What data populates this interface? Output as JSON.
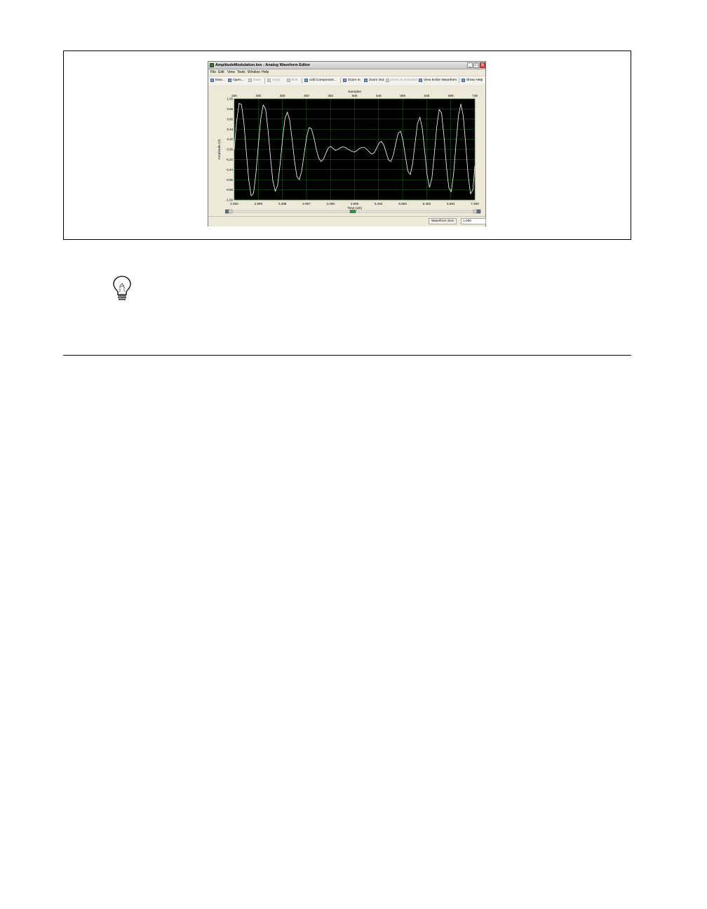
{
  "window": {
    "title": "AmplitudeModulation.lws - Analog Waveform Editor",
    "minimize_label": "_",
    "maximize_label": "□",
    "close_label": "✕"
  },
  "menu": {
    "items": [
      "File",
      "Edit",
      "View",
      "Tools",
      "Window",
      "Help"
    ]
  },
  "toolbar": {
    "new_label": "New...",
    "open_label": "Open...",
    "save_label": "Save",
    "copy_label": "Copy",
    "edit_label": "Edit",
    "add_component_label": "Add Component...",
    "zoom_in_label": "Zoom In",
    "zoom_out_label": "Zoom Out",
    "zoom_to_selection_label": "Zoom to Selection",
    "view_entire_label": "View Entire Waveform",
    "show_help_label": "Show Help"
  },
  "status": {
    "label": "Waveform Size",
    "value": "1,000"
  },
  "icons": {
    "tip": "lightbulb-icon"
  },
  "chart_data": {
    "type": "line",
    "top_axis_label": "Samples",
    "xlabel": "Time (uS)",
    "ylabel": "Amplitude (V)",
    "top_ticks": [
      "250",
      "300",
      "350",
      "400",
      "450",
      "500",
      "548",
      "599",
      "649",
      "699",
      "749"
    ],
    "bottom_ticks": [
      "2.500",
      "2.999",
      "3.498",
      "3.997",
      "4.496",
      "4.995",
      "5.494",
      "5.993",
      "6.492",
      "6.991",
      "7.490"
    ],
    "y_ticks": [
      "1.00",
      "0.88",
      "0.66",
      "0.44",
      "0.22",
      "0.00",
      "-0.22",
      "-0.44",
      "-0.66",
      "-0.88",
      "-1.00"
    ],
    "xlim": [
      2.5,
      7.49
    ],
    "ylim": [
      -1.0,
      1.0
    ],
    "grid": true,
    "background": "#000000",
    "grid_color": "#1f6b1f",
    "line_color": "#ffffff",
    "series": [
      {
        "x": [
          2.5,
          2.55,
          2.6,
          2.65,
          2.7,
          2.75,
          2.8,
          2.85,
          2.9,
          2.95,
          3.0,
          3.05,
          3.1,
          3.15,
          3.2,
          3.25,
          3.3,
          3.35,
          3.4,
          3.45,
          3.5,
          3.55,
          3.6,
          3.65,
          3.7,
          3.75,
          3.8,
          3.85,
          3.9,
          3.95,
          4.0,
          4.05,
          4.1,
          4.15,
          4.2,
          4.25,
          4.3,
          4.35,
          4.4,
          4.45,
          4.5,
          4.55,
          4.6,
          4.65,
          4.7,
          4.75,
          4.8,
          4.85,
          4.9,
          4.95,
          5.0,
          5.05,
          5.1,
          5.15,
          5.2,
          5.25,
          5.3,
          5.35,
          5.4,
          5.45,
          5.5,
          5.55,
          5.6,
          5.65,
          5.7,
          5.75,
          5.8,
          5.85,
          5.9,
          5.95,
          6.0,
          6.05,
          6.1,
          6.15,
          6.2,
          6.25,
          6.3,
          6.35,
          6.4,
          6.45,
          6.5,
          6.55,
          6.6,
          6.65,
          6.7,
          6.75,
          6.8,
          6.85,
          6.9,
          6.95,
          7.0,
          7.05,
          7.1,
          7.15,
          7.2,
          7.25,
          7.3,
          7.35,
          7.4,
          7.45,
          7.49
        ],
        "y": [
          0.0,
          0.57,
          0.91,
          0.89,
          0.52,
          -0.05,
          -0.6,
          -0.92,
          -0.87,
          -0.47,
          0.09,
          0.61,
          0.88,
          0.8,
          0.39,
          -0.15,
          -0.62,
          -0.83,
          -0.71,
          -0.3,
          0.19,
          0.6,
          0.74,
          0.58,
          0.2,
          -0.23,
          -0.54,
          -0.6,
          -0.42,
          -0.09,
          0.24,
          0.43,
          0.41,
          0.24,
          0.01,
          -0.17,
          -0.24,
          -0.19,
          -0.08,
          0.03,
          0.06,
          0.02,
          -0.02,
          0.0,
          0.03,
          0.05,
          0.04,
          0.01,
          -0.02,
          -0.04,
          -0.05,
          -0.02,
          0.02,
          0.04,
          0.04,
          0.0,
          -0.05,
          -0.09,
          -0.07,
          0.02,
          0.12,
          0.16,
          0.09,
          -0.06,
          -0.21,
          -0.24,
          -0.11,
          0.12,
          0.32,
          0.36,
          0.18,
          -0.14,
          -0.43,
          -0.5,
          -0.28,
          0.12,
          0.51,
          0.64,
          0.42,
          -0.03,
          -0.51,
          -0.75,
          -0.57,
          -0.09,
          0.45,
          0.79,
          0.72,
          0.26,
          -0.32,
          -0.76,
          -0.84,
          -0.48,
          0.12,
          0.67,
          0.9,
          0.66,
          0.1,
          -0.5,
          -0.88,
          -0.8,
          -0.33
        ]
      }
    ]
  }
}
